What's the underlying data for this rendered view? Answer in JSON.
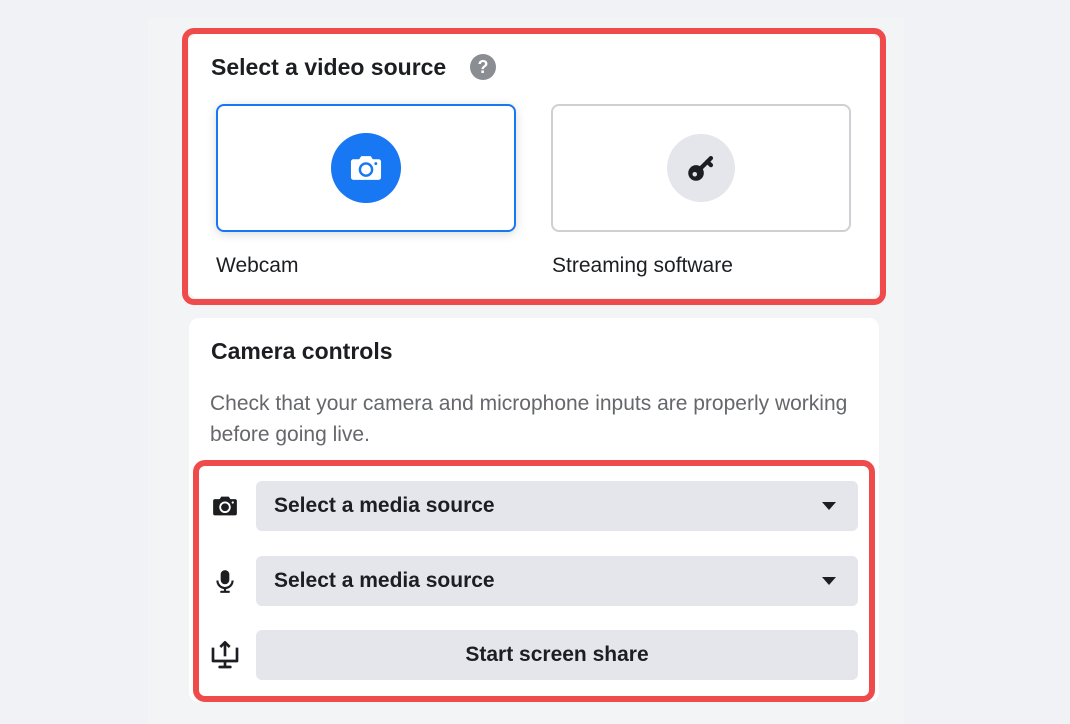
{
  "video_source": {
    "title": "Select a video source",
    "help_icon": "help-icon",
    "options": [
      {
        "label": "Webcam",
        "icon": "camera-icon",
        "selected": true
      },
      {
        "label": "Streaming software",
        "icon": "key-icon",
        "selected": false
      }
    ]
  },
  "camera_controls": {
    "title": "Camera controls",
    "description": "Check that your camera and microphone inputs are properly working before going live.",
    "camera_select": {
      "value": "Select a media source",
      "icon": "camera-icon"
    },
    "microphone_select": {
      "value": "Select a media source",
      "icon": "microphone-icon"
    },
    "screen_share": {
      "label": "Start screen share",
      "icon": "screen-share-icon"
    }
  },
  "colors": {
    "accent": "#1877f2",
    "highlight": "#ef4b4b",
    "control_background": "#e4e6eb"
  }
}
